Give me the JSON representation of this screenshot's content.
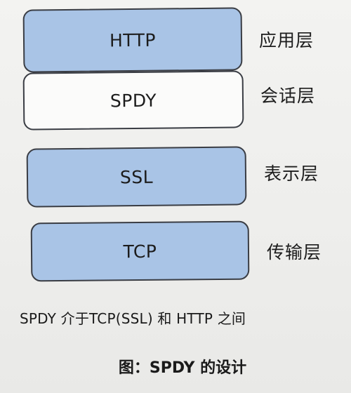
{
  "layers": [
    {
      "protocol": "HTTP",
      "name": "应用层",
      "fill": "#a9c4e6"
    },
    {
      "protocol": "SPDY",
      "name": "会话层",
      "fill": "#fbfbfa"
    },
    {
      "protocol": "SSL",
      "name": "表示层",
      "fill": "#a9c4e6"
    },
    {
      "protocol": "TCP",
      "name": "传输层",
      "fill": "#a9c4e6"
    }
  ],
  "caption": {
    "note": "SPDY 介于TCP(SSL) 和 HTTP 之间",
    "figure_title": "图：SPDY 的设计"
  },
  "colors": {
    "box_border": "#3a3d44",
    "page_background": "#efefed"
  }
}
